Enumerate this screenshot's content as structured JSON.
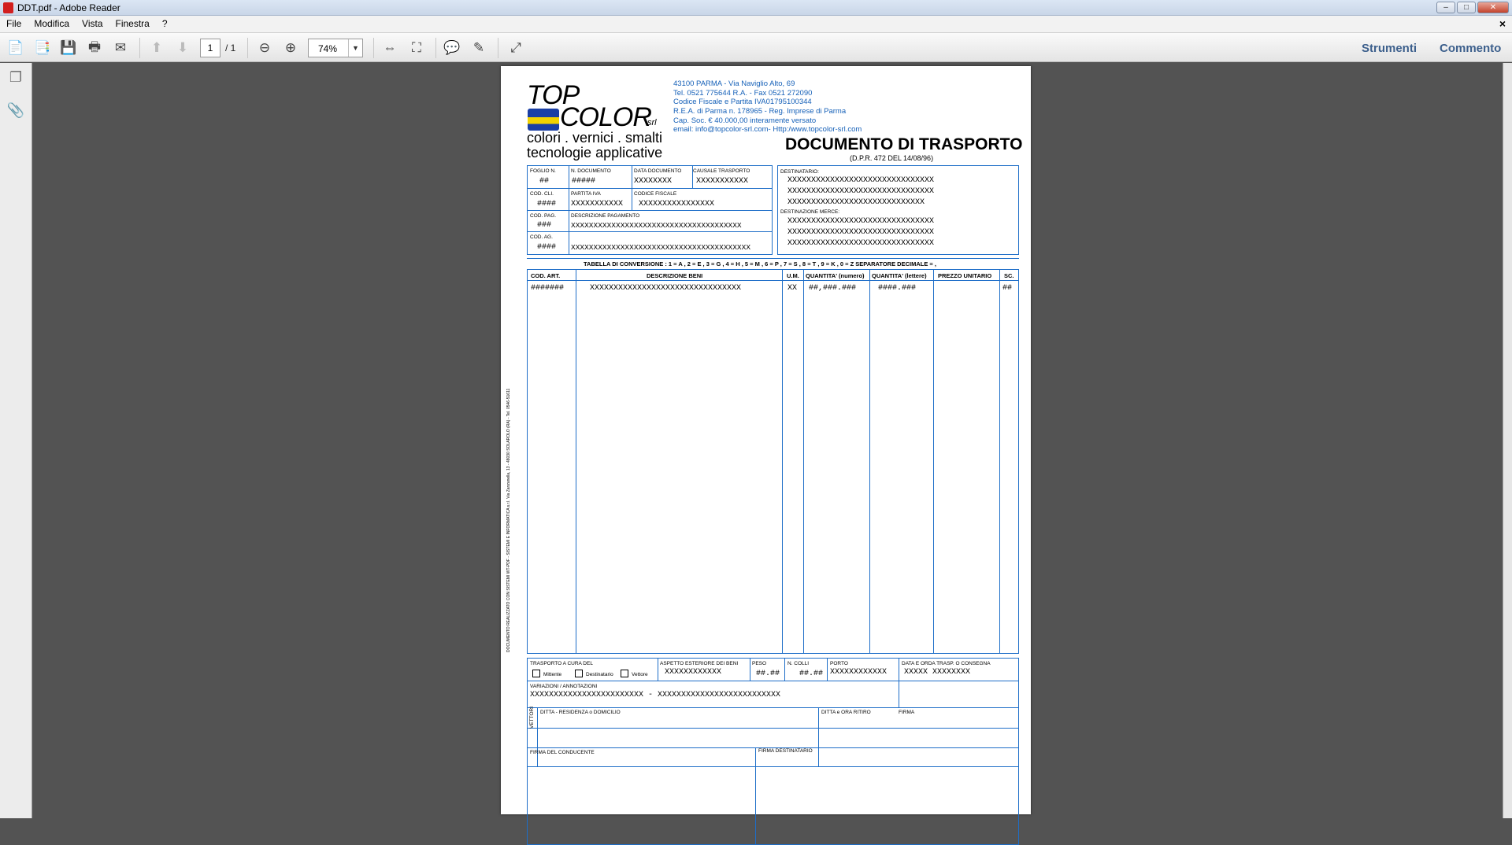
{
  "window": {
    "title": "DDT.pdf - Adobe Reader"
  },
  "menu": {
    "items": [
      "File",
      "Modifica",
      "Vista",
      "Finestra",
      "?"
    ],
    "close": "×"
  },
  "toolbar": {
    "page_value": "1",
    "page_total": "/ 1",
    "zoom": "74%",
    "tools": "Strumenti",
    "comment": "Commento"
  },
  "doc": {
    "logo_top": "TOP",
    "logo_color": "COLOR",
    "logo_srl": "srl",
    "slogan1": "colori . vernici . smalti",
    "slogan2": "tecnologie applicative",
    "address": [
      "43100 PARMA - Via Naviglio Alto, 69",
      "Tel. 0521 775644 R.A. - Fax 0521 272090",
      "Codice Fiscale e Partita IVA01795100344",
      "R.E.A. di Parma n. 178965 - Reg. Imprese di Parma",
      "Cap. Soc. € 40.000,00 interamente versato",
      "email: info@topcolor-srl.com- Http:/www.topcolor-srl.com"
    ],
    "title": "DOCUMENTO DI TRASPORTO",
    "subtitle": "(D.P.R. 472 DEL 14/08/96)",
    "hdr": {
      "foglio_l": "FOGLIO N.",
      "foglio_v": "##",
      "ndoc_l": "N. DOCUMENTO",
      "ndoc_v": "#####",
      "data_l": "DATA DOCUMENTO",
      "data_v": "XXXXXXXX",
      "causale_l": "CAUSALE TRASPORTO",
      "causale_v": "XXXXXXXXXXX",
      "codcli_l": "COD. CLI.",
      "codcli_v": "####",
      "piva_l": "PARTITA IVA",
      "piva_v": "XXXXXXXXXXX",
      "cf_l": "CODICE FISCALE",
      "cf_v": "XXXXXXXXXXXXXXXX",
      "codpag_l": "COD. PAG.",
      "codpag_v": "###",
      "descpag_l": "DESCRIZIONE PAGAMENTO",
      "descpag_v": "XXXXXXXXXXXXXXXXXXXXXXXXXXXXXXXXXXXXXX",
      "codag_l": "COD. AG.",
      "codag_v": "####",
      "codag_desc": "XXXXXXXXXXXXXXXXXXXXXXXXXXXXXXXXXXXXXXXX"
    },
    "dest": {
      "label": "DESTINATARIO:",
      "lines": [
        "XXXXXXXXXXXXXXXXXXXXXXXXXXXXXXX",
        "XXXXXXXXXXXXXXXXXXXXXXXXXXXXXXX",
        "XXXXXXXXXXXXXXXXXXXXXXXXXXXXX"
      ],
      "merce_label": "DESTINAZIONE MERCE:",
      "merce_lines": [
        "XXXXXXXXXXXXXXXXXXXXXXXXXXXXXXX",
        "XXXXXXXXXXXXXXXXXXXXXXXXXXXXXXX",
        "XXXXXXXXXXXXXXXXXXXXXXXXXXXXXXX"
      ]
    },
    "conversion": "TABELLA DI CONVERSIONE : 1 = A , 2 = E , 3 = G , 4 = H , 5 = M , 6 = P , 7 = S , 8 = T , 9 = K , 0 = Z   SEPARATORE DECIMALE = ,",
    "table": {
      "cols": [
        "COD. ART.",
        "DESCRIZIONE BENI",
        "U.M.",
        "QUANTITA' (numero)",
        "QUANTITA' (lettere)",
        "PREZZO UNITARIO",
        "SC."
      ],
      "row": [
        "#######",
        "XXXXXXXXXXXXXXXXXXXXXXXXXXXXXXXX",
        "XX",
        "##,###.###",
        "####.###",
        "",
        "##"
      ]
    },
    "footer": {
      "trasp_l": "TRASPORTO A CURA DEL",
      "mitt": "Mittente",
      "dest": "Destinatario",
      "vett": "Vettore",
      "aspetto_l": "ASPETTO ESTERIORE DEI BENI",
      "aspetto_v": "XXXXXXXXXXXX",
      "peso_l": "PESO",
      "peso_v": "##.##",
      "ncolli_l": "N. COLLI",
      "ncolli_v": "##.##",
      "porto_l": "PORTO",
      "porto_v": "XXXXXXXXXXXX",
      "dataora_l": "DATA E ORDA TRASP. O CONSEGNA",
      "dataora_v": "XXXXX  XXXXXXXX",
      "var_l": "VARIAZIONI / ANNOTAZIONI",
      "var_v": "XXXXXXXXXXXXXXXXXXXXXXXX  -  XXXXXXXXXXXXXXXXXXXXXXXXXX",
      "vettori": "VETTORI",
      "ditta_l": "DITTA - RESIDENZA o DOMICILIO",
      "ritiro_l": "DITTA e ORA RITIRO",
      "firma_l": "FIRMA",
      "firma_cond": "FIRMA DEL CONDUCENTE",
      "firma_dest": "FIRMA DESTINATARIO"
    },
    "side_text": "DOCUMENTO REALIZZATO CON SISTEMI WT-PDF - SISTEMI E INFORMATICA s.r.l. Via Zanzanella, 13 - 48030 SOLAROLO (RA) - Tel. 0546-51611"
  }
}
